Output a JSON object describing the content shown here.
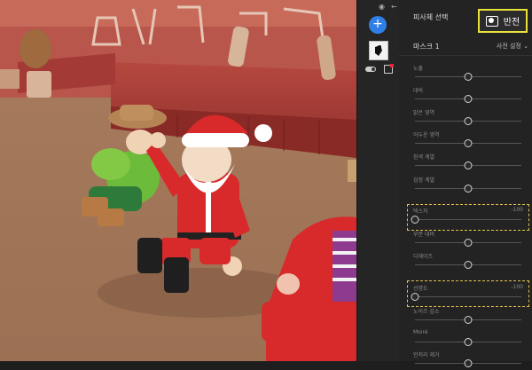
{
  "toolbar": {
    "eye_icon": "eye-icon",
    "back_icon": "back-arrow-icon",
    "add_label": "+"
  },
  "panel": {
    "title": "피사체 선택",
    "invert_label": "반전",
    "mask_name": "마스크 1",
    "preset_label": "사전 설정",
    "preset_icon": "chevron-down-icon"
  },
  "sliders": [
    {
      "label": "노출",
      "value_text": "",
      "position": 0.5
    },
    {
      "label": "대비",
      "value_text": "",
      "position": 0.5
    },
    {
      "label": "밝은 영역",
      "value_text": "",
      "position": 0.5
    },
    {
      "label": "어두운 영역",
      "value_text": "",
      "position": 0.5
    },
    {
      "label": "흰색 계열",
      "value_text": "",
      "position": 0.5
    },
    {
      "label": "검정 계열",
      "value_text": "",
      "position": 0.5
    },
    {
      "label": "텍스처",
      "value_text": "-100",
      "position": 0.0
    },
    {
      "label": "부분 대비",
      "value_text": "",
      "position": 0.5
    },
    {
      "label": "디헤이즈",
      "value_text": "",
      "position": 0.5
    },
    {
      "label": "선명도",
      "value_text": "-100",
      "position": 0.0
    },
    {
      "label": "노이즈 감소",
      "value_text": "",
      "position": 0.5
    },
    {
      "label": "Moiré",
      "value_text": "",
      "position": 0.5
    },
    {
      "label": "언저리 제거",
      "value_text": "",
      "position": 0.5
    }
  ],
  "colors": {
    "highlight": "#e5c34b",
    "accent": "#2f7fe6"
  }
}
